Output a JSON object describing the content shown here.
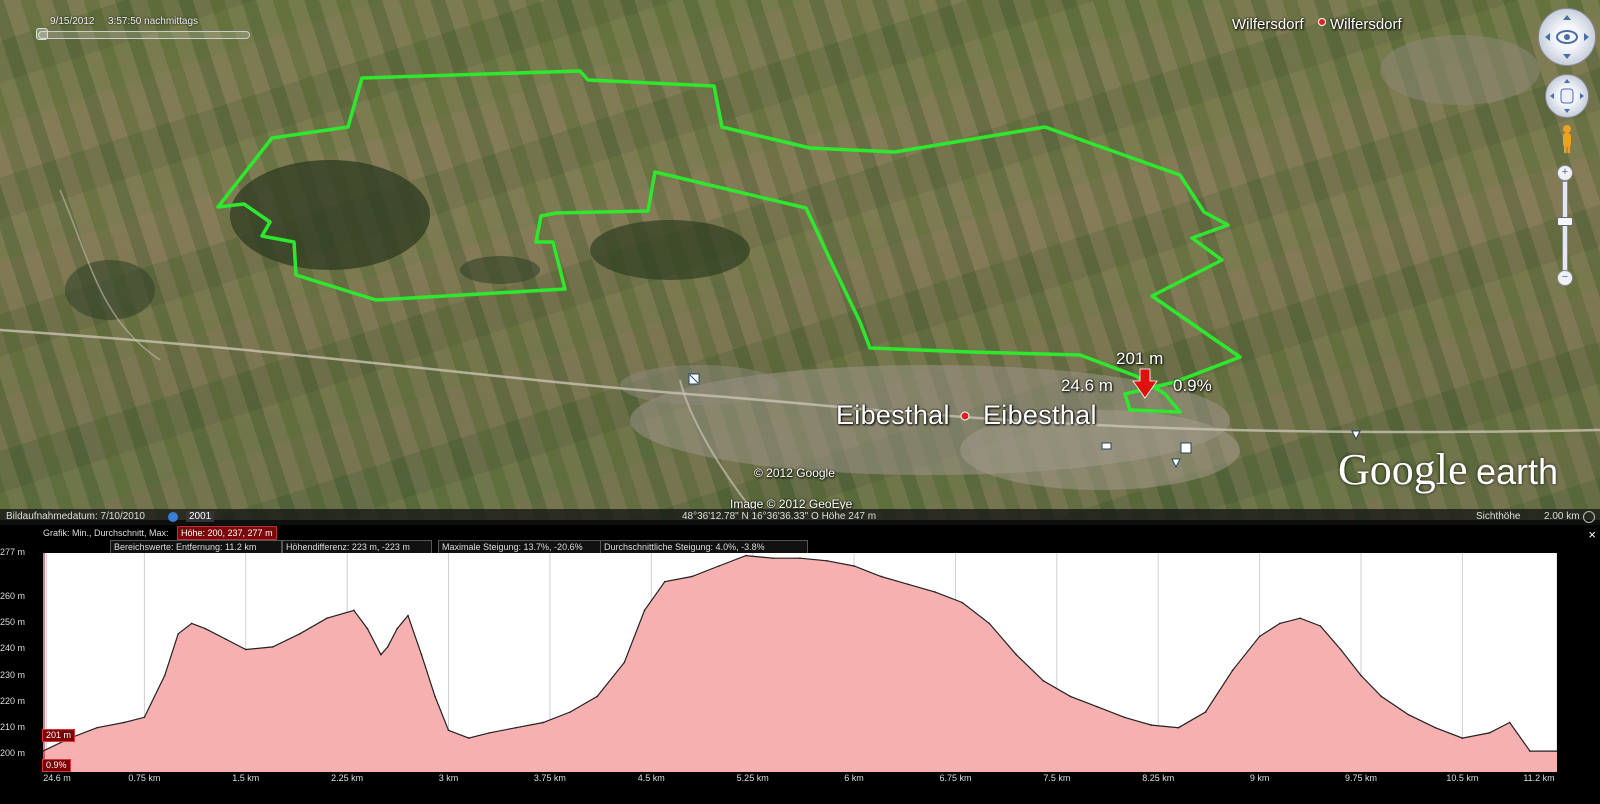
{
  "map": {
    "timestamp_date": "9/15/2012",
    "timestamp_time": "3:57:50 nachmittags",
    "town_north": "Wilfersdorf",
    "town_north_label": "Wilfersdorf",
    "town_main": "Eibesthal",
    "town_main_label": "Eibesthal",
    "marker_elevation": "201 m",
    "marker_distance": "24.6 m",
    "marker_slope": "0.9%",
    "copyright_google": "© 2012 Google",
    "copyright_image": "Image © 2012 GeoEye",
    "brand_google": "Google",
    "brand_earth": "earth",
    "track_color": "#2ee82e"
  },
  "statusbar": {
    "imagery_date_label": "Bildaufnahmedatum: 7/10/2010",
    "year_badge": "2001",
    "coordinates": "48°36'12.78\" N  16°36'36.33\" O  Höhe  247 m",
    "eye_alt_label": "Sichthöhe",
    "eye_alt_value": "2.00 km"
  },
  "graph_header": {
    "graph_label": "Grafik: Min., Durchschnitt, Max:",
    "elevation_stats": "Höhe: 200, 237, 277 m",
    "range_label": "Bereichswerte: Entfernung: 11.2 km",
    "elevation_diff": "Höhendifferenz: 223 m, -223 m",
    "max_slope": "Maximale Steigung: 13.7%, -20.6%",
    "avg_slope": "Durchschnittliche Steigung: 4.0%, -3.8%",
    "close_glyph": "×"
  },
  "chart_data": {
    "type": "area",
    "title": "",
    "xlabel": "",
    "ylabel": "",
    "x_unit": "km",
    "y_unit": "m",
    "xlim": [
      0,
      11.2
    ],
    "ylim": [
      193,
      277
    ],
    "y_ticks": [
      "277 m",
      "260 m",
      "250 m",
      "240 m",
      "230 m",
      "220 m",
      "210 m",
      "200 m"
    ],
    "y_tick_values": [
      277,
      260,
      250,
      240,
      230,
      220,
      210,
      200
    ],
    "x_ticks": [
      "24.6 m",
      "0.75 km",
      "1.5 km",
      "2.25 km",
      "3 km",
      "3.75 km",
      "4.5 km",
      "5.25 km",
      "6 km",
      "6.75 km",
      "7.5 km",
      "8.25 km",
      "9 km",
      "9.75 km",
      "10.5 km",
      "11.2 km"
    ],
    "x_tick_values": [
      0.0246,
      0.75,
      1.5,
      2.25,
      3,
      3.75,
      4.5,
      5.25,
      6,
      6.75,
      7.5,
      8.25,
      9,
      9.75,
      10.5,
      11.2
    ],
    "fill_color": "#f6b0b0",
    "line_color": "#222222",
    "grid": true,
    "cursor_value_label": "201 m",
    "cursor_slope_label": "0.9%",
    "series": [
      {
        "x": [
          0,
          0.2,
          0.4,
          0.6,
          0.75,
          0.9,
          1.0,
          1.1,
          1.2,
          1.35,
          1.5,
          1.7,
          1.9,
          2.1,
          2.3,
          2.4,
          2.5,
          2.55,
          2.62,
          2.7,
          2.8,
          2.9,
          3.0,
          3.15,
          3.3,
          3.5,
          3.7,
          3.9,
          4.1,
          4.3,
          4.45,
          4.6,
          4.8,
          5.0,
          5.2,
          5.4,
          5.6,
          5.8,
          6.0,
          6.2,
          6.4,
          6.6,
          6.8,
          7.0,
          7.2,
          7.4,
          7.6,
          7.8,
          8.0,
          8.2,
          8.4,
          8.6,
          8.8,
          9.0,
          9.15,
          9.3,
          9.45,
          9.6,
          9.75,
          9.9,
          10.1,
          10.3,
          10.5,
          10.7,
          10.85,
          11.0,
          11.2
        ],
        "y": [
          201,
          206,
          210,
          212,
          214,
          230,
          246,
          250,
          248,
          244,
          240,
          241,
          246,
          252,
          255,
          248,
          238,
          241,
          248,
          253,
          238,
          222,
          209,
          206,
          208,
          210,
          212,
          216,
          222,
          235,
          255,
          266,
          268,
          272,
          276,
          275,
          275,
          274,
          272,
          268,
          265,
          262,
          258,
          250,
          238,
          228,
          222,
          218,
          214,
          211,
          210,
          216,
          232,
          245,
          250,
          252,
          249,
          240,
          230,
          222,
          215,
          210,
          206,
          208,
          212,
          201,
          201
        ]
      }
    ]
  }
}
